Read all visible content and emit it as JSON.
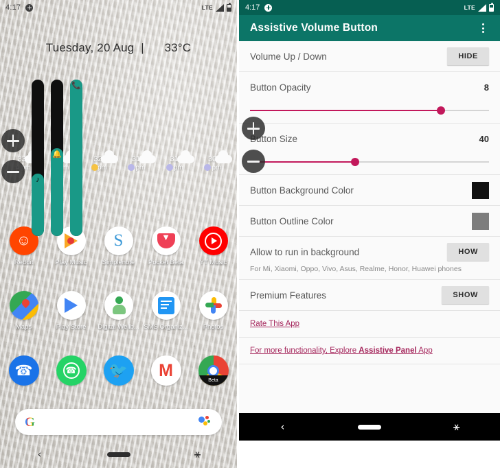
{
  "home": {
    "status_bar": {
      "time": "4:17",
      "plus_icon": "plus-circle-icon",
      "network": "LTE",
      "signal_icon": "signal-icon",
      "battery_icon": "battery-icon"
    },
    "date_widget": "Tuesday, 20 Aug  |      33°C",
    "weather": [
      {
        "temp": "33°",
        "time": "4 pm",
        "icon": "cloud-icon"
      },
      {
        "temp": "32°",
        "time": "5 pm",
        "icon": "cloud-icon"
      },
      {
        "temp": "32°",
        "time": "6 pm",
        "icon": "sun-cloud-icon"
      },
      {
        "temp": "31°",
        "time": "7 pm",
        "icon": "moon-cloud-icon"
      },
      {
        "temp": "31°",
        "time": "8 pm",
        "icon": "moon-cloud-icon"
      },
      {
        "temp": "30°",
        "time": "9 pm",
        "icon": "moon-cloud-icon"
      }
    ],
    "volume_bars": [
      {
        "name": "media-volume-bar",
        "glyph": "♪",
        "fill_percent": 40
      },
      {
        "name": "ring-volume-bar",
        "glyph": "🔔",
        "fill_percent": 56
      },
      {
        "name": "call-volume-bar",
        "glyph": "📞",
        "fill_percent": 100
      }
    ],
    "assistive_buttons": [
      {
        "name": "volume-up-floating-button",
        "label": "+"
      },
      {
        "name": "volume-down-floating-button",
        "label": "–"
      }
    ],
    "app_rows": [
      [
        {
          "label": "Reddit",
          "icon": "reddit-icon"
        },
        {
          "label": "Play Music",
          "icon": "play-music-icon"
        },
        {
          "label": "Simplenote",
          "icon": "simplenote-icon"
        },
        {
          "label": "Pocket Beta",
          "icon": "pocket-icon"
        },
        {
          "label": "YT Music",
          "icon": "youtube-music-icon"
        }
      ],
      [
        {
          "label": "Maps",
          "icon": "google-maps-icon"
        },
        {
          "label": "Play Store",
          "icon": "play-store-icon"
        },
        {
          "label": "Digital Wellb...",
          "icon": "digital-wellbeing-icon"
        },
        {
          "label": "SMS Organiz...",
          "icon": "sms-organizer-icon"
        },
        {
          "label": "Photos",
          "icon": "google-photos-icon"
        }
      ],
      [
        {
          "label": "",
          "icon": "phone-icon"
        },
        {
          "label": "",
          "icon": "whatsapp-icon"
        },
        {
          "label": "",
          "icon": "twitter-icon"
        },
        {
          "label": "",
          "icon": "gmail-icon"
        },
        {
          "label": "",
          "icon": "chrome-beta-icon"
        }
      ]
    ],
    "search": {
      "logo": "google-g-logo",
      "assistant_icon": "google-assistant-icon"
    },
    "nav": {
      "back": "‹",
      "home": "home-pill",
      "accessibility": "accessibility-icon"
    }
  },
  "app": {
    "status_bar": {
      "time": "4:17",
      "plus_icon": "plus-circle-icon",
      "network": "LTE",
      "signal_icon": "signal-icon",
      "battery_icon": "battery-icon"
    },
    "title": "Assistive Volume Button",
    "overflow_icon": "kebab-menu-icon",
    "rows": [
      {
        "label": "Volume Up / Down",
        "button": "HIDE"
      },
      {
        "label": "Button Opacity",
        "value": "8",
        "slider_percent": 80
      },
      {
        "label": "Button Size",
        "value": "40",
        "slider_percent": 44
      },
      {
        "label": "Button Background Color",
        "swatch": "#111111"
      },
      {
        "label": "Button Outline Color",
        "swatch": "#7d7d7d"
      },
      {
        "label": "Allow to run in background",
        "button": "HOW",
        "sub": "For Mi, Xiaomi, Oppo, Vivo, Asus, Realme, Honor, Huawei phones"
      },
      {
        "label": "Premium Features",
        "button": "SHOW"
      }
    ],
    "links": [
      {
        "text": "Rate This App"
      },
      {
        "prefix": "For more functionality, Explore ",
        "bold": "Assistive Panel",
        "suffix": " App"
      }
    ],
    "assistive_buttons": [
      {
        "name": "volume-up-floating-button",
        "label": "+"
      },
      {
        "name": "volume-down-floating-button",
        "label": "–"
      }
    ],
    "nav": {
      "back": "‹",
      "home": "home-pill",
      "accessibility": "accessibility-icon"
    },
    "colors": {
      "status_bar": "#065f52",
      "app_bar": "#0c7567",
      "accent": "#c2185b",
      "link": "#a5265c"
    }
  }
}
